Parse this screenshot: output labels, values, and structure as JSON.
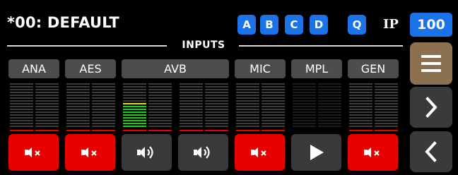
{
  "header": {
    "preset_title": "*00: DEFAULT",
    "preset_buttons": [
      "A",
      "B",
      "C",
      "D"
    ],
    "q_button": "Q",
    "ip_label": "IP",
    "ip_value": "100"
  },
  "section_label": "INPUTS",
  "channel_tabs": [
    "ANA",
    "AES",
    "AVB",
    "MIC",
    "MPL",
    "GEN"
  ],
  "meters": [
    {
      "level_segments": 0,
      "peak": "red"
    },
    {
      "level_segments": 0,
      "peak": "red"
    },
    {
      "level_segments": 0,
      "peak": "red"
    },
    {
      "level_segments": 0,
      "peak": "red"
    },
    {
      "level_segments": 9,
      "peak_segment_color": "yellow",
      "peak": "red"
    },
    {
      "level_segments": 0,
      "peak": "red"
    },
    {
      "level_segments": 0,
      "peak": "red"
    },
    {
      "level_segments": 0,
      "peak": "red"
    },
    {
      "level_segments": 0,
      "peak": "red"
    },
    {
      "level_segments": 0,
      "peak": "red"
    },
    {
      "level_segments": 0,
      "peak": "none"
    },
    {
      "level_segments": 0,
      "peak": "none"
    },
    {
      "level_segments": 0,
      "peak": "red"
    },
    {
      "level_segments": 0,
      "peak": "red"
    }
  ],
  "mute_buttons": [
    {
      "channel": "ANA",
      "state": "muted",
      "icon": "speaker-muted-icon"
    },
    {
      "channel": "AES",
      "state": "muted",
      "icon": "speaker-muted-icon"
    },
    {
      "channel": "AVB-1",
      "state": "unmuted",
      "icon": "speaker-on-icon"
    },
    {
      "channel": "AVB-2",
      "state": "unmuted",
      "icon": "speaker-on-icon"
    },
    {
      "channel": "MIC",
      "state": "muted",
      "icon": "speaker-muted-icon"
    },
    {
      "channel": "MPL",
      "state": "play",
      "icon": "play-icon"
    },
    {
      "channel": "GEN",
      "state": "muted",
      "icon": "speaker-muted-icon"
    }
  ],
  "side_buttons": {
    "menu_icon": "hamburger-menu-icon",
    "next_icon": "chevron-right-icon",
    "prev_icon": "chevron-left-icon"
  },
  "colors": {
    "accent_blue": "#1a73e8",
    "mute_red": "#e80000",
    "menu_brown": "#8c7150",
    "button_grey": "#3a3a3a",
    "tab_grey": "#4d4d4d",
    "meter_green": "#22cc22",
    "meter_yellow": "#e8e000"
  }
}
